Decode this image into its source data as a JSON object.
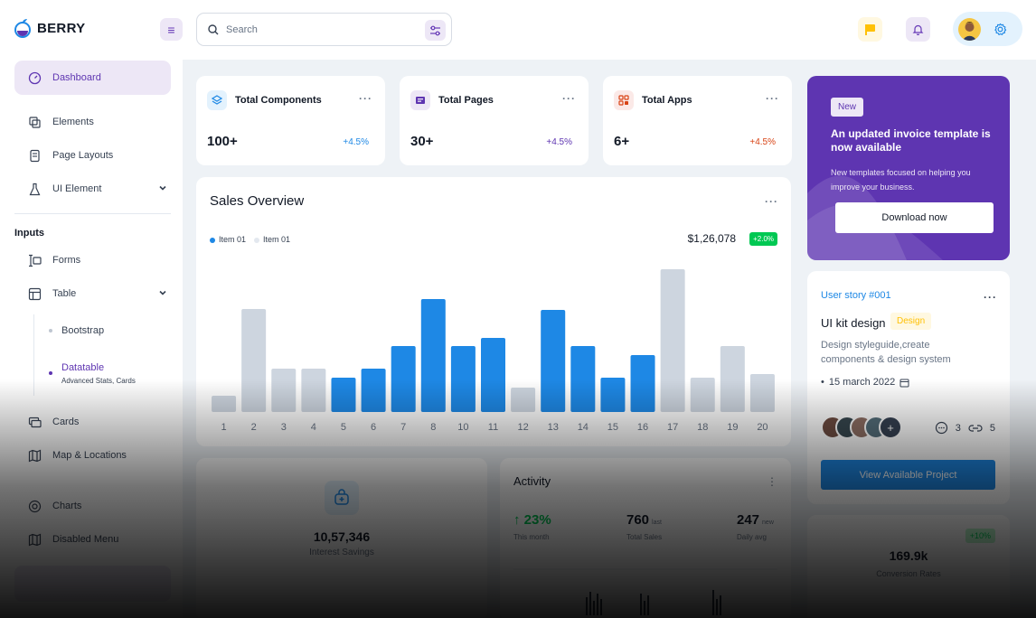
{
  "app": {
    "name": "BERRY"
  },
  "search": {
    "placeholder": "Search"
  },
  "sidebar": {
    "items": [
      {
        "label": "Dashboard"
      },
      {
        "label": "Elements"
      },
      {
        "label": "Page Layouts"
      },
      {
        "label": "UI Element"
      },
      {
        "label": "Forms"
      },
      {
        "label": "Table"
      },
      {
        "label": "Cards"
      },
      {
        "label": "Map & Locations"
      },
      {
        "label": "Charts"
      },
      {
        "label": "Disabled Menu"
      }
    ],
    "heading": "Inputs",
    "sub_items": [
      {
        "label": "Bootstrap"
      },
      {
        "label": "Datatable",
        "caption": "Advanced Stats,  Cards"
      }
    ]
  },
  "stats": [
    {
      "title": "Total Components",
      "value": "100+",
      "change": "+4.5%",
      "color": "#1e88e5"
    },
    {
      "title": "Total Pages",
      "value": "30+",
      "change": "+4.5%",
      "color": "#5e35b1"
    },
    {
      "title": "Total Apps",
      "value": "6+",
      "change": "+4.5%",
      "color": "#d84315"
    }
  ],
  "sales": {
    "title": "Sales Overview",
    "legend": [
      "Item 01",
      "Item 01"
    ],
    "total": "$1,26,078",
    "badge": "+2.0%"
  },
  "chart_data": {
    "type": "bar",
    "categories": [
      "1",
      "2",
      "3",
      "4",
      "5",
      "6",
      "7",
      "8",
      "10",
      "11",
      "12",
      "13",
      "14",
      "15",
      "16",
      "17",
      "18",
      "19",
      "20"
    ],
    "series": [
      {
        "name": "Item 01",
        "color": "#1e88e5",
        "highlight": [
          false,
          false,
          false,
          false,
          true,
          true,
          true,
          true,
          true,
          true,
          false,
          true,
          true,
          true,
          true,
          false,
          false,
          false,
          false
        ]
      }
    ],
    "values": [
      18,
      114,
      48,
      48,
      38,
      48,
      73,
      125,
      73,
      82,
      27,
      113,
      73,
      38,
      63,
      158,
      38,
      73,
      42
    ],
    "ylim": [
      0,
      165
    ]
  },
  "promo": {
    "badge": "New",
    "title": "An updated invoice template is now available",
    "desc": "New templates focused on helping you improve your business.",
    "button": "Download now"
  },
  "story": {
    "id": "User story #001",
    "title": "UI kit design",
    "tag": "Design",
    "desc": "Design styleguide,create components & design system",
    "date": "15 march 2022",
    "comments": "3",
    "links": "5",
    "button": "View Available Project"
  },
  "savings": {
    "value": "10,57,346",
    "label": "Interest Savings"
  },
  "activity": {
    "title": "Activity",
    "stats": [
      {
        "value": "23%",
        "unit": "",
        "caption": "This month",
        "color": "#00c853"
      },
      {
        "value": "760",
        "unit": "last",
        "caption": "Total Sales",
        "color": "#121926"
      },
      {
        "value": "247",
        "unit": "new",
        "caption": "Daily avg",
        "color": "#121926"
      }
    ]
  },
  "conversion": {
    "badge": "+10%",
    "value": "169.9k",
    "label": "Conversion Rates"
  }
}
